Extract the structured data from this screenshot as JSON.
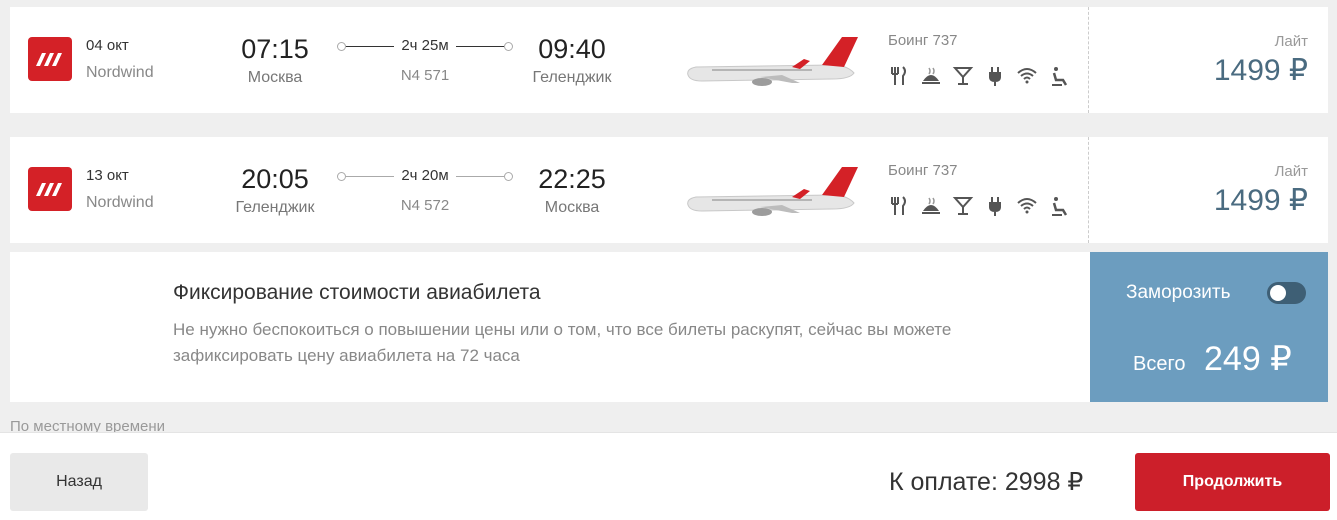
{
  "flights": [
    {
      "date": "04 окт",
      "airline": "Nordwind",
      "departure_time": "07:15",
      "departure_city": "Москва",
      "duration": "2ч 25м",
      "flight_number": "N4 571",
      "arrival_time": "09:40",
      "arrival_city": "Геленджик",
      "aircraft": "Боинг 737",
      "fare_class": "Лайт",
      "price": "1499 ₽"
    },
    {
      "date": "13 окт",
      "airline": "Nordwind",
      "departure_time": "20:05",
      "departure_city": "Геленджик",
      "duration": "2ч 20м",
      "flight_number": "N4 572",
      "arrival_time": "22:25",
      "arrival_city": "Москва",
      "aircraft": "Боинг 737",
      "fare_class": "Лайт",
      "price": "1499 ₽"
    }
  ],
  "amenity_icons": [
    "meal-icon",
    "hot-food-icon",
    "drinks-icon",
    "power-outlet-icon",
    "wifi-icon",
    "seat-icon"
  ],
  "freeze": {
    "title": "Фиксирование стоимости авиабилета",
    "description": "Не нужно беспокоиться о повышении цены или о том, что все билеты раскупят, сейчас вы можете зафиксировать цену авиабилета на 72 часа",
    "toggle_label": "Заморозить",
    "toggle_on": false,
    "total_label": "Всего",
    "total_value": "249 ₽"
  },
  "local_time_note": "По местному времени",
  "footer": {
    "back_label": "Назад",
    "to_pay": "К оплате: 2998 ₽",
    "continue_label": "Продолжить"
  },
  "colors": {
    "brand_red": "#d42127",
    "price_blue": "#4a6b80",
    "freeze_panel": "#6c9dbf",
    "continue_button": "#cc1f2a"
  }
}
